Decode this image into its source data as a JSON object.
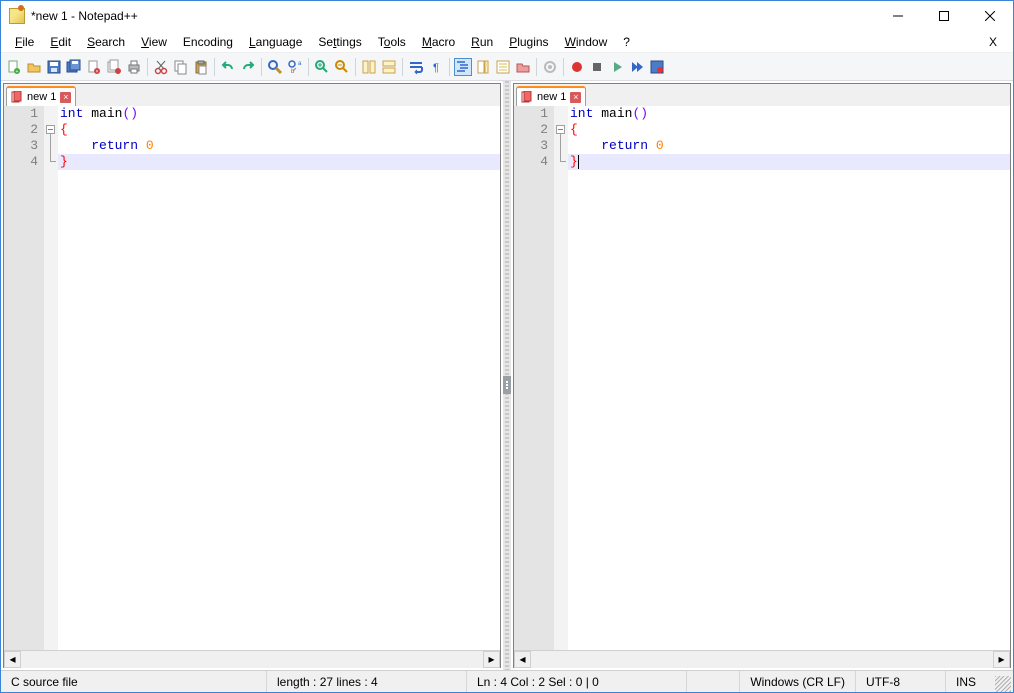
{
  "window": {
    "title": "*new 1 - Notepad++"
  },
  "menu": {
    "file": "File",
    "edit": "Edit",
    "search": "Search",
    "view": "View",
    "encoding": "Encoding",
    "language": "Language",
    "settings": "Settings",
    "tools": "Tools",
    "macro": "Macro",
    "run": "Run",
    "plugins": "Plugins",
    "window": "Window",
    "help": "?",
    "close_x": "X"
  },
  "toolbar_icons": [
    "new-file",
    "open-file",
    "save",
    "save-all",
    "close",
    "close-all",
    "print",
    "sep",
    "cut",
    "copy",
    "paste",
    "sep",
    "undo",
    "redo",
    "sep",
    "find",
    "replace",
    "sep",
    "zoom-in",
    "zoom-out",
    "sep",
    "sync-v",
    "sync-h",
    "sep",
    "word-wrap",
    "show-all-chars",
    "sep",
    "indent-guide",
    "doc-map",
    "function-list",
    "folder-ws",
    "sep",
    "monitoring",
    "sep",
    "record-macro",
    "stop-macro",
    "play-macro",
    "play-multi",
    "save-macro"
  ],
  "tabs": {
    "left": {
      "label": "new 1",
      "modified": true
    },
    "right": {
      "label": "new 1",
      "modified": true
    }
  },
  "code": {
    "lines": [
      {
        "n": "1",
        "tokens": [
          [
            "kw",
            "int"
          ],
          [
            "sp",
            " "
          ],
          [
            "ident",
            "main"
          ],
          [
            "paren",
            "()"
          ]
        ]
      },
      {
        "n": "2",
        "tokens": [
          [
            "brace",
            "{"
          ]
        ]
      },
      {
        "n": "3",
        "tokens": [
          [
            "sp",
            "    "
          ],
          [
            "kw",
            "return"
          ],
          [
            "sp",
            " "
          ],
          [
            "num",
            "0"
          ]
        ]
      },
      {
        "n": "4",
        "tokens": [
          [
            "brace",
            "}"
          ]
        ],
        "hl": true,
        "caret_after": true
      }
    ]
  },
  "status": {
    "filetype": "C source file",
    "length": "length : 27    lines : 4",
    "pos": "Ln : 4    Col : 2    Sel : 0 | 0",
    "eol": "Windows (CR LF)",
    "enc": "UTF-8",
    "mode": "INS"
  }
}
